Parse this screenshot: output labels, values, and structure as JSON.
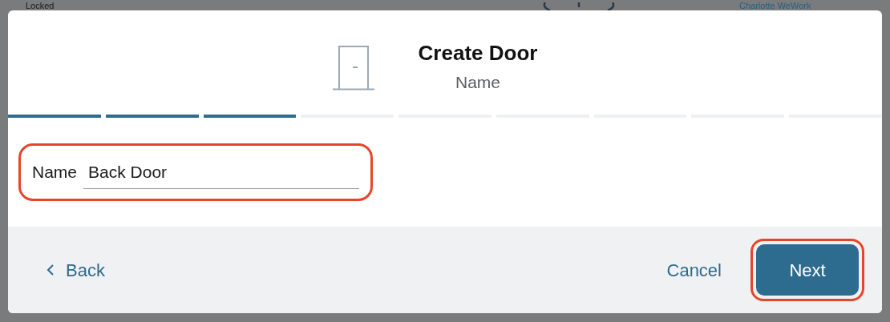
{
  "background": {
    "status": "Locked",
    "location": "Charlotte WeWork"
  },
  "dialog": {
    "title": "Create Door",
    "subtitle": "Name"
  },
  "steps": [
    {
      "done": true
    },
    {
      "done": true
    },
    {
      "done": true
    },
    {
      "done": false
    },
    {
      "done": false
    },
    {
      "done": false
    },
    {
      "done": false
    },
    {
      "done": false
    },
    {
      "done": false
    }
  ],
  "field": {
    "label": "Name",
    "value": "Back Door",
    "highlighted": true
  },
  "footer": {
    "back": "Back",
    "cancel": "Cancel",
    "next": "Next",
    "next_highlighted": true
  }
}
